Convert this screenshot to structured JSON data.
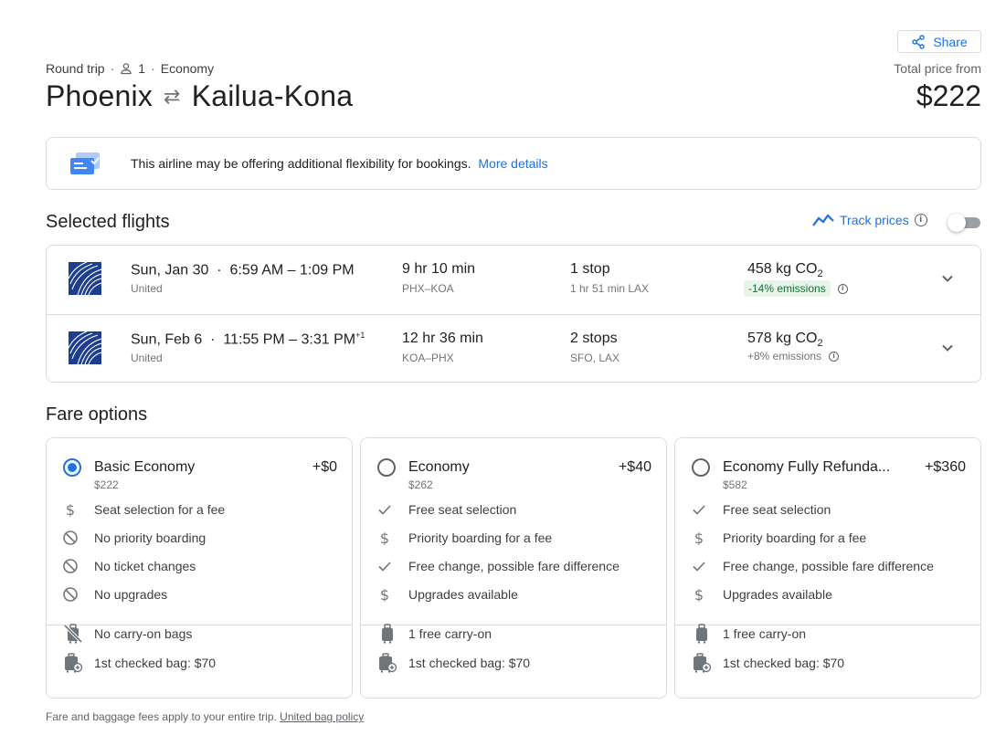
{
  "header": {
    "share_label": "Share",
    "trip_type": "Round trip",
    "passengers": "1",
    "cabin": "Economy",
    "origin": "Phoenix",
    "destination": "Kailua-Kona",
    "total_label": "Total price from",
    "total_price": "$222"
  },
  "notice": {
    "text": "This airline may be offering additional flexibility for bookings.",
    "link": "More details"
  },
  "selected": {
    "title": "Selected flights",
    "track_label": "Track prices",
    "track_enabled": false,
    "flights": [
      {
        "date": "Sun, Jan 30",
        "times": "6:59 AM – 1:09 PM",
        "day_offset": "",
        "airline": "United",
        "duration": "9 hr 10 min",
        "route": "PHX–KOA",
        "stops": "1 stop",
        "stop_detail": "1 hr 51 min LAX",
        "co2": "458 kg CO",
        "co2_sub": "2",
        "emissions": "-14% emissions",
        "emissions_highlight": true
      },
      {
        "date": "Sun, Feb 6",
        "times": "11:55 PM – 3:31 PM",
        "day_offset": "+1",
        "airline": "United",
        "duration": "12 hr 36 min",
        "route": "KOA–PHX",
        "stops": "2 stops",
        "stop_detail": "SFO, LAX",
        "co2": "578 kg CO",
        "co2_sub": "2",
        "emissions": "+8% emissions",
        "emissions_highlight": false
      }
    ]
  },
  "fares": {
    "title": "Fare options",
    "options": [
      {
        "name": "Basic Economy",
        "price": "$222",
        "add": "+$0",
        "selected": true,
        "features": [
          {
            "icon": "dollar-icon",
            "text": "Seat selection for a fee"
          },
          {
            "icon": "block-icon",
            "text": "No priority boarding"
          },
          {
            "icon": "block-icon",
            "text": "No ticket changes"
          },
          {
            "icon": "block-icon",
            "text": "No upgrades"
          }
        ],
        "bags": [
          {
            "icon": "no-carry-on-icon",
            "text": "No carry-on bags"
          },
          {
            "icon": "checked-bag-icon",
            "text": "1st checked bag: $70"
          }
        ]
      },
      {
        "name": "Economy",
        "price": "$262",
        "add": "+$40",
        "selected": false,
        "features": [
          {
            "icon": "check-icon",
            "text": "Free seat selection"
          },
          {
            "icon": "dollar-icon",
            "text": "Priority boarding for a fee"
          },
          {
            "icon": "check-icon",
            "text": "Free change, possible fare difference"
          },
          {
            "icon": "dollar-icon",
            "text": "Upgrades available"
          }
        ],
        "bags": [
          {
            "icon": "carry-on-icon",
            "text": "1 free carry-on"
          },
          {
            "icon": "checked-bag-icon",
            "text": "1st checked bag: $70"
          }
        ]
      },
      {
        "name": "Economy Fully Refunda...",
        "price": "$582",
        "add": "+$360",
        "selected": false,
        "features": [
          {
            "icon": "check-icon",
            "text": "Free seat selection"
          },
          {
            "icon": "dollar-icon",
            "text": "Priority boarding for a fee"
          },
          {
            "icon": "check-icon",
            "text": "Free change, possible fare difference"
          },
          {
            "icon": "dollar-icon",
            "text": "Upgrades available"
          }
        ],
        "bags": [
          {
            "icon": "carry-on-icon",
            "text": "1 free carry-on"
          },
          {
            "icon": "checked-bag-icon",
            "text": "1st checked bag: $70"
          }
        ]
      }
    ]
  },
  "footer": {
    "text": "Fare and baggage fees apply to your entire trip.",
    "link": "United bag policy"
  },
  "colors": {
    "accent": "#1a73e8",
    "emission_good_bg": "#e6f4ea",
    "emission_good_text": "#137333",
    "united_blue": "#1d3d8f"
  }
}
